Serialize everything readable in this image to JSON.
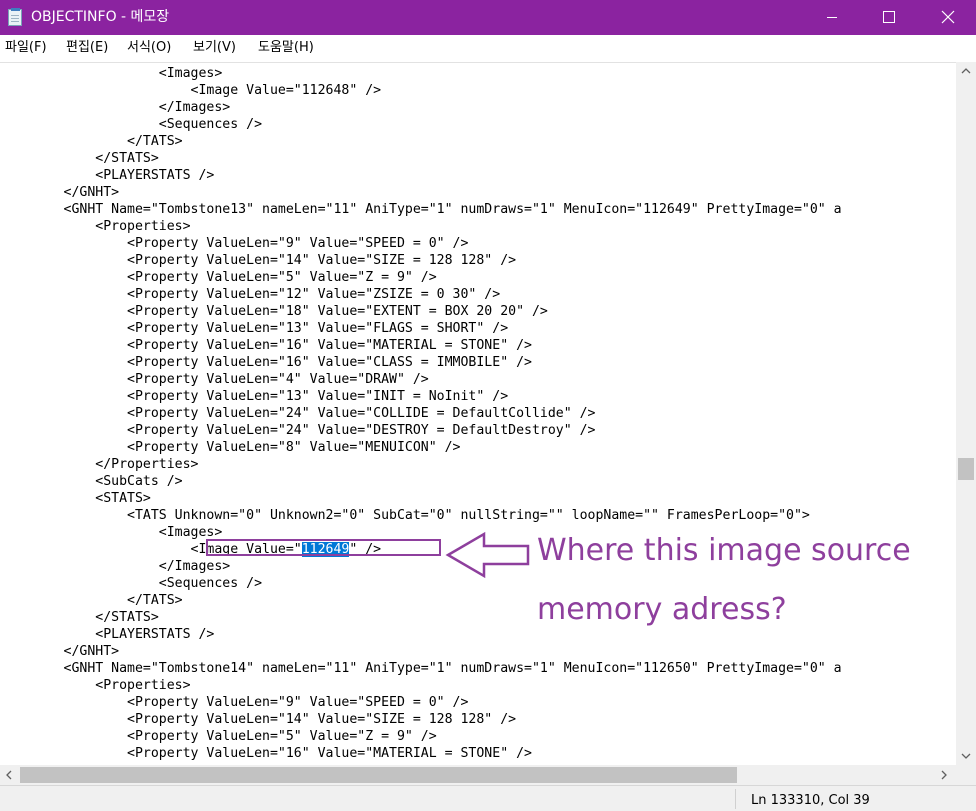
{
  "window": {
    "title": "OBJECTINFO - 메모장",
    "icon": "notepad-icon",
    "controls": [
      "minimize-icon",
      "maximize-icon",
      "close-icon"
    ],
    "title_bar_color": "#8b23a0"
  },
  "menu": {
    "items": [
      "파일(F)",
      "편집(E)",
      "서식(O)",
      "보기(V)",
      "도움말(H)"
    ]
  },
  "editor": {
    "lines": [
      "                    <Images>",
      "                        <Image Value=\"112648\" />",
      "                    </Images>",
      "                    <Sequences />",
      "                </TATS>",
      "            </STATS>",
      "            <PLAYERSTATS />",
      "        </GNHT>",
      "        <GNHT Name=\"Tombstone13\" nameLen=\"11\" AniType=\"1\" numDraws=\"1\" MenuIcon=\"112649\" PrettyImage=\"0\" a",
      "            <Properties>",
      "                <Property ValueLen=\"9\" Value=\"SPEED = 0\" />",
      "                <Property ValueLen=\"14\" Value=\"SIZE = 128 128\" />",
      "                <Property ValueLen=\"5\" Value=\"Z = 9\" />",
      "                <Property ValueLen=\"12\" Value=\"ZSIZE = 0 30\" />",
      "                <Property ValueLen=\"18\" Value=\"EXTENT = BOX 20 20\" />",
      "                <Property ValueLen=\"13\" Value=\"FLAGS = SHORT\" />",
      "                <Property ValueLen=\"16\" Value=\"MATERIAL = STONE\" />",
      "                <Property ValueLen=\"16\" Value=\"CLASS = IMMOBILE\" />",
      "                <Property ValueLen=\"4\" Value=\"DRAW\" />",
      "                <Property ValueLen=\"13\" Value=\"INIT = NoInit\" />",
      "                <Property ValueLen=\"24\" Value=\"COLLIDE = DefaultCollide\" />",
      "                <Property ValueLen=\"24\" Value=\"DESTROY = DefaultDestroy\" />",
      "                <Property ValueLen=\"8\" Value=\"MENUICON\" />",
      "            </Properties>",
      "            <SubCats />",
      "            <STATS>",
      "                <TATS Unknown=\"0\" Unknown2=\"0\" SubCat=\"0\" nullString=\"\" loopName=\"\" FramesPerLoop=\"0\">",
      "                    <Images>",
      "                        <Image Value=\"112649\" />",
      "                    </Images>",
      "                    <Sequences />",
      "                </TATS>",
      "            </STATS>",
      "            <PLAYERSTATS />",
      "        </GNHT>",
      "        <GNHT Name=\"Tombstone14\" nameLen=\"11\" AniType=\"1\" numDraws=\"1\" MenuIcon=\"112650\" PrettyImage=\"0\" a",
      "            <Properties>",
      "                <Property ValueLen=\"9\" Value=\"SPEED = 0\" />",
      "                <Property ValueLen=\"14\" Value=\"SIZE = 128 128\" />",
      "                <Property ValueLen=\"5\" Value=\"Z = 9\" />",
      "                <Property ValueLen=\"16\" Value=\"MATERIAL = STONE\" />"
    ],
    "selection": {
      "line_index": 28,
      "text": "112649"
    },
    "selection_color": "#0078d7"
  },
  "status": {
    "position": "Ln 133310, Col 39"
  },
  "annotation": {
    "line1": "Where this image source",
    "line2": "memory adress?",
    "color": "#8e3f9d"
  }
}
